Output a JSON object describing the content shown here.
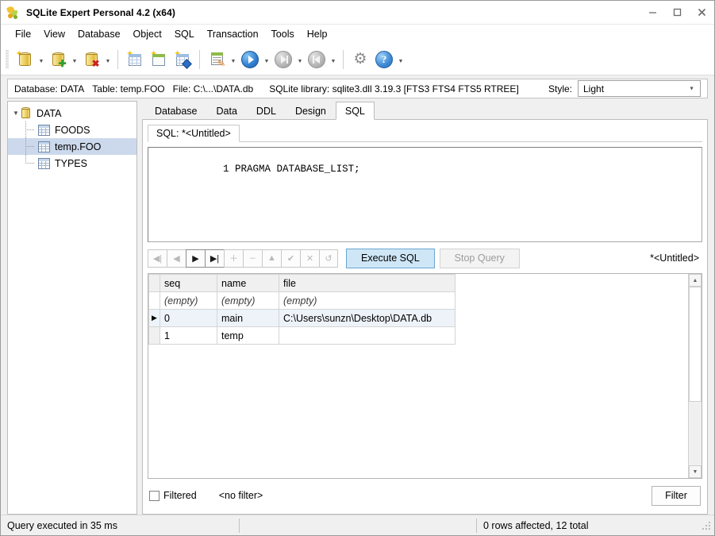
{
  "window": {
    "title": "SQLite Expert Personal 4.2 (x64)",
    "app_icon": "sqlite-expert-icon",
    "minimize_label": "─",
    "maximize_label": "□",
    "close_label": "✕"
  },
  "menubar": {
    "items": [
      {
        "label": "File"
      },
      {
        "label": "View"
      },
      {
        "label": "Database"
      },
      {
        "label": "Object"
      },
      {
        "label": "SQL"
      },
      {
        "label": "Transaction"
      },
      {
        "label": "Tools"
      },
      {
        "label": "Help"
      }
    ]
  },
  "toolbar": {
    "buttons": [
      {
        "name": "new-database-icon",
        "dropdown": true
      },
      {
        "name": "add-database-icon",
        "dropdown": true
      },
      {
        "name": "remove-database-icon",
        "dropdown": true
      },
      {
        "name": "new-table-icon",
        "dropdown": false
      },
      {
        "name": "new-view-icon",
        "dropdown": false
      },
      {
        "name": "new-index-icon",
        "dropdown": false
      },
      {
        "name": "sql-editor-icon",
        "dropdown": true
      },
      {
        "name": "execute-icon",
        "dropdown": true
      },
      {
        "name": "step-forward-icon",
        "dropdown": true
      },
      {
        "name": "step-back-icon",
        "dropdown": true
      },
      {
        "name": "options-gear-icon",
        "dropdown": false
      },
      {
        "name": "help-icon",
        "dropdown": true
      }
    ]
  },
  "infobar": {
    "database_label": "Database: DATA",
    "table_label": "Table: temp.FOO",
    "file_label": "File: C:\\...\\DATA.db",
    "library_label": "SQLite library: sqlite3.dll 3.19.3 [FTS3 FTS4 FTS5 RTREE]",
    "style_label": "Style:",
    "style_value": "Light",
    "style_options": [
      "Light"
    ]
  },
  "tree": {
    "root": {
      "label": "DATA",
      "icon": "database-icon",
      "expanded": true
    },
    "children": [
      {
        "label": "FOODS",
        "icon": "table-icon",
        "selected": false
      },
      {
        "label": "temp.FOO",
        "icon": "table-icon",
        "selected": true
      },
      {
        "label": "TYPES",
        "icon": "table-icon",
        "selected": false
      }
    ]
  },
  "tabs": {
    "items": [
      {
        "label": "Database",
        "active": false
      },
      {
        "label": "Data",
        "active": false
      },
      {
        "label": "DDL",
        "active": false
      },
      {
        "label": "Design",
        "active": false
      },
      {
        "label": "SQL",
        "active": true
      }
    ]
  },
  "subtabs": {
    "items": [
      {
        "label": "SQL: *<Untitled>",
        "active": true
      }
    ]
  },
  "editor": {
    "line_number": "1",
    "text": "PRAGMA DATABASE_LIST;"
  },
  "navigator": {
    "buttons": [
      {
        "name": "first-record-button",
        "glyph": "◀|",
        "enabled": false
      },
      {
        "name": "prior-record-button",
        "glyph": "◀",
        "enabled": false
      },
      {
        "name": "next-record-button",
        "glyph": "▶",
        "enabled": true
      },
      {
        "name": "last-record-button",
        "glyph": "▶|",
        "enabled": true
      },
      {
        "name": "insert-record-button",
        "glyph": "＋",
        "enabled": false
      },
      {
        "name": "delete-record-button",
        "glyph": "‒",
        "enabled": false
      },
      {
        "name": "edit-record-button",
        "glyph": "▲",
        "enabled": false
      },
      {
        "name": "post-edit-button",
        "glyph": "✔",
        "enabled": false
      },
      {
        "name": "cancel-edit-button",
        "glyph": "✕",
        "enabled": false
      },
      {
        "name": "refresh-button",
        "glyph": "↺",
        "enabled": false
      }
    ],
    "execute_label": "Execute SQL",
    "stop_label": "Stop Query",
    "title_right": "*<Untitled>"
  },
  "grid": {
    "columns": [
      "seq",
      "name",
      "file"
    ],
    "filter_row": [
      "(empty)",
      "(empty)",
      "(empty)"
    ],
    "rows": [
      {
        "selected": true,
        "indicator": "▶",
        "cells": [
          "0",
          "main",
          "C:\\Users\\sunzn\\Desktop\\DATA.db"
        ]
      },
      {
        "selected": false,
        "indicator": "",
        "cells": [
          "1",
          "temp",
          ""
        ]
      }
    ]
  },
  "filterbar": {
    "checkbox_label": "Filtered",
    "checked": false,
    "filter_text": "<no filter>",
    "filter_button": "Filter"
  },
  "statusbar": {
    "left": "Query executed in 35 ms",
    "middle": "",
    "right": "0 rows affected, 12 total"
  },
  "colors": {
    "accent_blue": "#cfe6f7",
    "tree_selection": "#ccd9ec",
    "grid_selection": "#eef3fa",
    "chrome": "#f0f0f0"
  }
}
